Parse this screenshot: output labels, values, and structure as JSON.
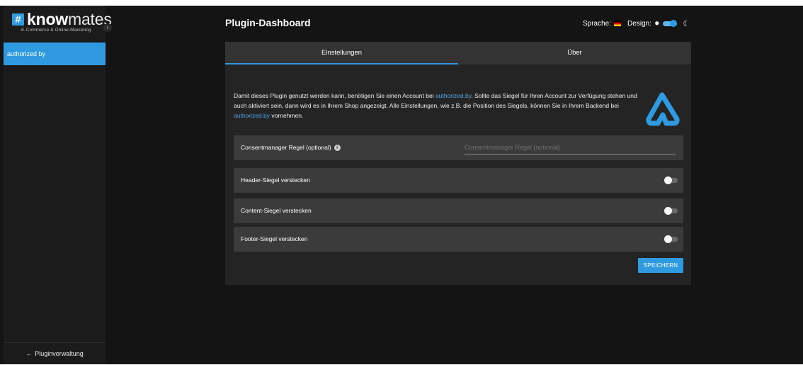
{
  "brand": {
    "logo_hash": "#",
    "logo_bold": "know",
    "logo_light": "mates",
    "tagline": "E-Commerce & Online-Marketing"
  },
  "sidebar": {
    "collapse_icon": "chevron-left-icon",
    "items": [
      {
        "label": "authorized by",
        "active": true
      }
    ],
    "footer_label": "Pluginverwaltung"
  },
  "header": {
    "title": "Plugin-Dashboard",
    "language_label": "Sprache:",
    "language_flag": "german-flag-icon",
    "design_label": "Design:",
    "design_mode": "dark"
  },
  "tabs": [
    {
      "label": "Einstellungen",
      "active": true
    },
    {
      "label": "Über",
      "active": false
    }
  ],
  "intro": {
    "part1": "Damit dieses Plugin genutzt werden kann, benötigen Sie einen Account bei ",
    "link1": "authorized.by",
    "part2": ". Sollte das Siegel für Ihren Account zur Verfügung stehen und auch aktiviert sein, dann wird es in Ihrem Shop angezeigt. Alle Einstellungen, wie z.B. die Position des Siegels, können Sie in Ihrem Backend bei ",
    "link2": "authorized.by",
    "part3": " vornehmen."
  },
  "settings": {
    "consent_label": "Consentmanager Regel (optional)",
    "consent_placeholder": "Consentmanager Regel (optional)",
    "consent_value": "",
    "header_seal_label": "Header-Siegel verstecken",
    "header_seal_on": false,
    "content_seal_label": "Content-Siegel verstecken",
    "content_seal_on": false,
    "footer_seal_label": "Footer-Siegel verstecken",
    "footer_seal_on": false
  },
  "actions": {
    "save_label": "SPEICHERN"
  },
  "colors": {
    "accent": "#2f9ae0",
    "background": "#141414",
    "card": "#242424",
    "row": "#3b3b3b"
  }
}
